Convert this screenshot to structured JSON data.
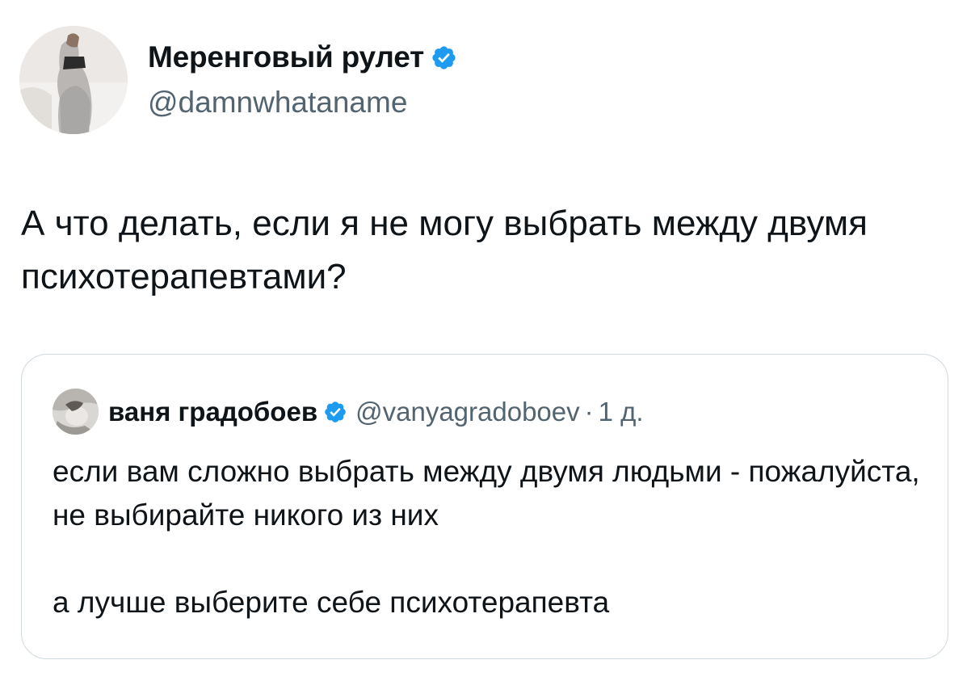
{
  "tweet": {
    "author_name": "Меренговый рулет",
    "author_handle": "@damnwhataname",
    "avatar_icon": "user-photo-avatar",
    "verified_icon": "verified-badge-icon",
    "text": "А что делать, если я не могу выбрать между двумя психотерапевтами?"
  },
  "quote": {
    "author_name": "ваня градобоев",
    "author_handle": "@vanyagradoboev",
    "separator": "·",
    "time": "1 д.",
    "avatar_icon": "user-photo-avatar",
    "verified_icon": "verified-badge-icon",
    "line1": "если вам сложно выбрать между двумя людьми - пожалуйста, не выбирайте никого из них",
    "line2": "а лучше выберите себе психотерапевта"
  },
  "colors": {
    "verified": "#1d9bf0",
    "text": "#0f1419",
    "secondary": "#536471",
    "border": "#cfd9de"
  }
}
